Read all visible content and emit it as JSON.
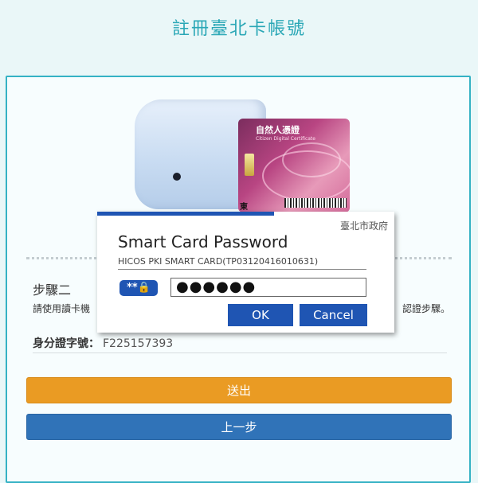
{
  "page": {
    "title": "註冊臺北卡帳號"
  },
  "illustration": {
    "card_title": "自然人憑證",
    "card_subtitle": "Citizen Digital Certificate",
    "card_char": "東"
  },
  "step": {
    "title": "步驟二",
    "instruction_left": "請使用讀卡機",
    "instruction_right": "認證步驟。"
  },
  "id_field": {
    "label": "身分證字號：",
    "value": "F225157393"
  },
  "buttons": {
    "submit": "送出",
    "previous": "上一步"
  },
  "dialog": {
    "issuer": "臺北市政府",
    "title": "Smart Card Password",
    "subtitle": "HICOS PKI SMART CARD(TP03120416010631)",
    "password_icon_text": "**🔒",
    "password_value": "●●●●●●",
    "ok_label": "OK",
    "cancel_label": "Cancel"
  },
  "colors": {
    "title": "#2aa7b6",
    "panel_border": "#35b2c4",
    "submit": "#ea9b23",
    "previous": "#3073b8",
    "dialog_accent": "#1f55b3"
  }
}
